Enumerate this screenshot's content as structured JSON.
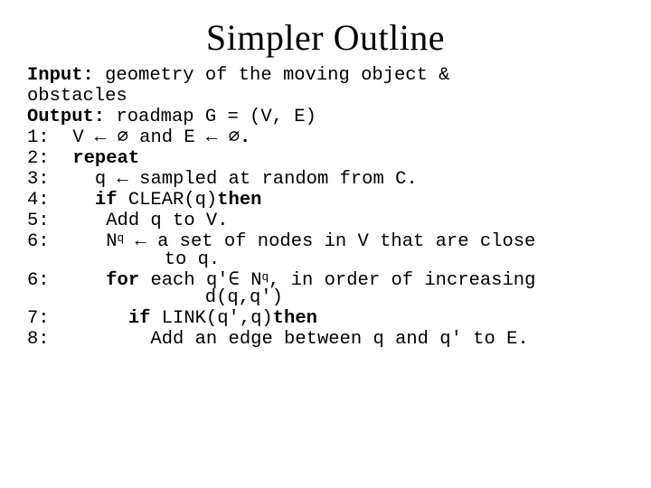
{
  "title": "Simpler Outline",
  "io": {
    "input_label": "Input:",
    "input_text": " geometry of the moving object &",
    "input_cont": "obstacles",
    "output_label": "Output:",
    "output_text": " roadmap G = (V, E)"
  },
  "steps": {
    "s1_lab": "1:",
    "s1_body_a": " V ← ∅ and E ← ∅",
    "s1_body_b": ".",
    "s2_lab": "2:",
    "s2_body": " repeat",
    "s3_lab": "3:",
    "s3_body_a": "   q ",
    "s3_body_b": "←",
    "s3_body_c": " sampled at random from C.",
    "s4_lab": "4:",
    "s4_body_a": "   ",
    "s4_body_b": "if ",
    "s4_body_c": "CLEAR(q)",
    "s4_body_d": "then",
    "s5_lab": "5:",
    "s5_body": "    Add q to V.",
    "s6a_lab": "6:",
    "s6a_body_a": "    N",
    "s6a_sub": "q",
    "s6a_body_b": " ← ",
    "s6a_body_c": "a set of nodes in V that are close",
    "s6a_cont": "to q.",
    "s6b_lab": "6:",
    "s6b_body_a": "    ",
    "s6b_body_b": "for ",
    "s6b_body_c": "each q'∈ N",
    "s6b_sub": "q",
    "s6b_body_d": ", in order of increasing",
    "s6b_cont": "d(q,q')",
    "s7_lab": "7:",
    "s7_body_a": "      ",
    "s7_body_b": "if ",
    "s7_body_c": "LINK(q',q)",
    "s7_body_d": "then",
    "s8_lab": "8:",
    "s8_body": "        Add an edge between q and q' to E."
  }
}
